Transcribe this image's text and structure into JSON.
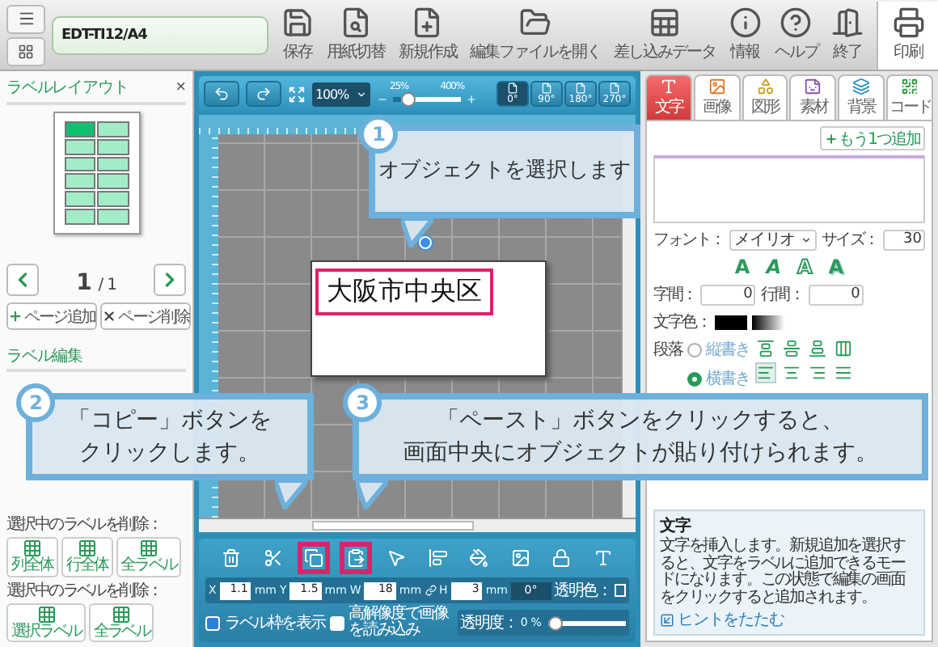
{
  "header": {
    "file_name": "EDT-TI12/A4",
    "tools": [
      {
        "kind": "save",
        "label": "保存"
      },
      {
        "kind": "paper",
        "label": "用紙切替"
      },
      {
        "kind": "new",
        "label": "新規作成"
      },
      {
        "kind": "open",
        "label": "編集ファイルを開く"
      },
      {
        "kind": "merge",
        "label": "差し込みデータ"
      },
      {
        "kind": "info",
        "label": "情報"
      },
      {
        "kind": "help",
        "label": "ヘルプ"
      },
      {
        "kind": "exit",
        "label": "終了"
      }
    ],
    "print": {
      "label": "印刷"
    }
  },
  "layout_panel": {
    "title": "ラベルレイアウト",
    "close": "×",
    "cells": [
      {
        "selected": true
      },
      {
        "selected": false
      },
      {
        "selected": false
      },
      {
        "selected": false
      },
      {
        "selected": false
      },
      {
        "selected": false
      },
      {
        "selected": false
      },
      {
        "selected": false
      },
      {
        "selected": false
      },
      {
        "selected": false
      },
      {
        "selected": false
      },
      {
        "selected": false
      }
    ],
    "page": "1",
    "page_total": "/ 1",
    "page_buttons": [
      {
        "kind": "add",
        "label": "ページ追加"
      },
      {
        "kind": "delete",
        "label": "ページ削除"
      }
    ],
    "section": "ラベル編集",
    "groups": [
      {
        "heading": "選択中のラベルを削除：",
        "buttons": [
          "列全体",
          "行全体",
          "全ラベル"
        ]
      },
      {
        "heading": "選択中のラベルを削除：",
        "buttons": [
          "選択ラベル",
          "全ラベル"
        ]
      }
    ]
  },
  "canvas": {
    "zoom": "100%",
    "zoom_min": "25%",
    "zoom_max": "400%",
    "level": 0.15,
    "rotations": [
      {
        "label": "0°",
        "selected": true
      },
      {
        "label": "90°",
        "selected": false
      },
      {
        "label": "180°",
        "selected": false
      },
      {
        "label": "270°",
        "selected": false
      }
    ],
    "label_text": "大阪市中央区",
    "label_selected": true
  },
  "object_bar": {
    "tools": [
      {
        "kind": "delete",
        "highlighted": false
      },
      {
        "kind": "cut",
        "highlighted": false
      },
      {
        "kind": "copy",
        "highlighted": true
      },
      {
        "kind": "paste",
        "highlighted": true
      },
      {
        "kind": "select",
        "highlighted": false
      },
      {
        "kind": "align",
        "highlighted": false
      },
      {
        "kind": "fill",
        "highlighted": false
      },
      {
        "kind": "image",
        "highlighted": false
      },
      {
        "kind": "lock",
        "highlighted": false
      },
      {
        "kind": "text",
        "highlighted": false
      }
    ],
    "fields": [
      {
        "label": "X",
        "value": "1.1",
        "unit": "mm"
      },
      {
        "label": "Y",
        "value": "1.5",
        "unit": "mm"
      },
      {
        "label": "W",
        "value": "18",
        "unit": "mm"
      },
      {
        "label": "H",
        "value": "3",
        "unit": "mm"
      }
    ],
    "angle": "0°",
    "transparent_color": "透明色：",
    "show_frame": {
      "label": "ラベル枠を表示",
      "checked": true
    },
    "hires": {
      "label": "高解像度で画像を読み込み",
      "checked": false
    },
    "opacity": {
      "label": "透明度：",
      "value": "0",
      "unit": "%",
      "level": 0.05
    }
  },
  "properties": {
    "tabs": [
      {
        "kind": "text",
        "label": "文字",
        "selected": true
      },
      {
        "kind": "image",
        "label": "画像",
        "selected": false
      },
      {
        "kind": "shape",
        "label": "図形",
        "selected": false
      },
      {
        "kind": "material",
        "label": "素材",
        "selected": false
      },
      {
        "kind": "background",
        "label": "背景",
        "selected": false
      },
      {
        "kind": "code",
        "label": "コード",
        "selected": false
      }
    ],
    "add_button": "もう1つ追加",
    "font_label": "フォント：",
    "font": "メイリオ",
    "size_label": "サイズ：",
    "size": "30",
    "styles": [
      {
        "kind": "normal",
        "glyph": "A"
      },
      {
        "kind": "italic",
        "glyph": "A"
      },
      {
        "kind": "outline",
        "glyph": "A"
      },
      {
        "kind": "shadow",
        "glyph": "A"
      }
    ],
    "spacing": [
      {
        "label": "字間：",
        "value": "0"
      },
      {
        "label": "行間：",
        "value": "0"
      }
    ],
    "color_label": "文字色：",
    "paragraph_label": "段落",
    "directions": [
      {
        "label": "縦書き",
        "selected": false
      },
      {
        "label": "横書き",
        "selected": true
      }
    ],
    "valign": [
      {
        "selected": false
      },
      {
        "selected": false
      },
      {
        "selected": false
      },
      {
        "selected": false
      }
    ],
    "halign": [
      {
        "selected": true
      },
      {
        "selected": false
      },
      {
        "selected": false
      },
      {
        "selected": false
      }
    ]
  },
  "hint": {
    "title": "文字",
    "text": "文字を挿入します。新規追加を選択すると、文字をラベルに追加できるモードになります。この状態で編集の画面をクリックすると追加されます。",
    "link": "ヒントをたたむ"
  },
  "callouts": [
    {
      "number": "1",
      "lines": [
        "オブジェクトを選択します"
      ]
    },
    {
      "number": "2",
      "lines": [
        "「コピー」ボタンを",
        "クリックします。"
      ]
    },
    {
      "number": "3",
      "lines": [
        "「ペースト」ボタンをクリックすると、",
        "画面中央にオブジェクトが貼り付けられます。"
      ]
    }
  ]
}
